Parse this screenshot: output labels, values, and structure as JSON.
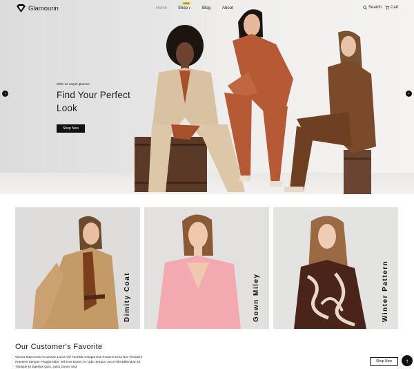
{
  "brand": {
    "name": "Glamourin"
  },
  "nav": {
    "items": [
      {
        "label": "Home"
      },
      {
        "label": "Shop"
      },
      {
        "label": "Blog"
      },
      {
        "label": "About"
      }
    ],
    "shop_badge": "NEW",
    "search_label": "Search",
    "cart_label": "Cart"
  },
  "hero": {
    "kicker": "With red carpet glamour",
    "title": "Find Your Perfect Look",
    "button_label": "Shop Now"
  },
  "categories": [
    {
      "label": "Dimity Coat"
    },
    {
      "label": "Gown Miley"
    },
    {
      "label": "Winter Pattern"
    }
  ],
  "favorites": {
    "title": "Our Customer's Favorite",
    "description": "Viverra Maecenas Accumsan Lacus Vel Facilisis Volutpat Est. Posuere Urna Nec Tincidunt Praesent Semper Feugiat Nibh. Vel Eros Donec Ac Odio Tempor. Arcu Felis Bibendum Ut Tristique Et Egestas Quis. Justo Donec Sed",
    "button_label": "Shop Now"
  },
  "icons": {
    "logo": "diamond-logo-icon",
    "search": "search-icon",
    "cart": "cart-icon",
    "prev": "chevron-left-icon",
    "next": "chevron-right-icon",
    "to_top": "arrow-up-icon"
  },
  "colors": {
    "accent": "#111111",
    "badge": "#f2d24b",
    "rust": "#b65a35",
    "camel": "#d2b48c",
    "brown": "#7a4a2a",
    "pink": "#f2aab0"
  }
}
